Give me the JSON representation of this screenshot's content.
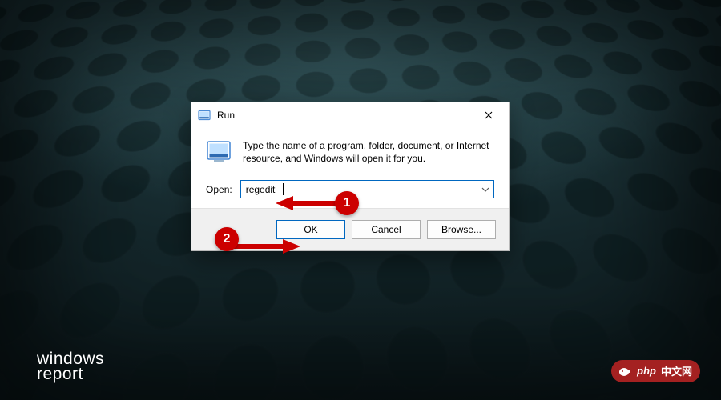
{
  "colors": {
    "accent": "#0067c0",
    "annotation": "#cc0000",
    "dialog_bg": "#ffffff",
    "button_bar_bg": "#f0f0f0"
  },
  "dialog": {
    "title": "Run",
    "description": "Type the name of a program, folder, document, or Internet resource, and Windows will open it for you.",
    "open_label": "Open:",
    "input_value": "regedit",
    "buttons": {
      "ok": "OK",
      "cancel": "Cancel",
      "browse": "Browse..."
    }
  },
  "annotations": {
    "badge1": "1",
    "badge2": "2"
  },
  "watermarks": {
    "left_line1": "windows",
    "left_line2": "report",
    "right_text": "中文网",
    "right_prefix": "php"
  }
}
